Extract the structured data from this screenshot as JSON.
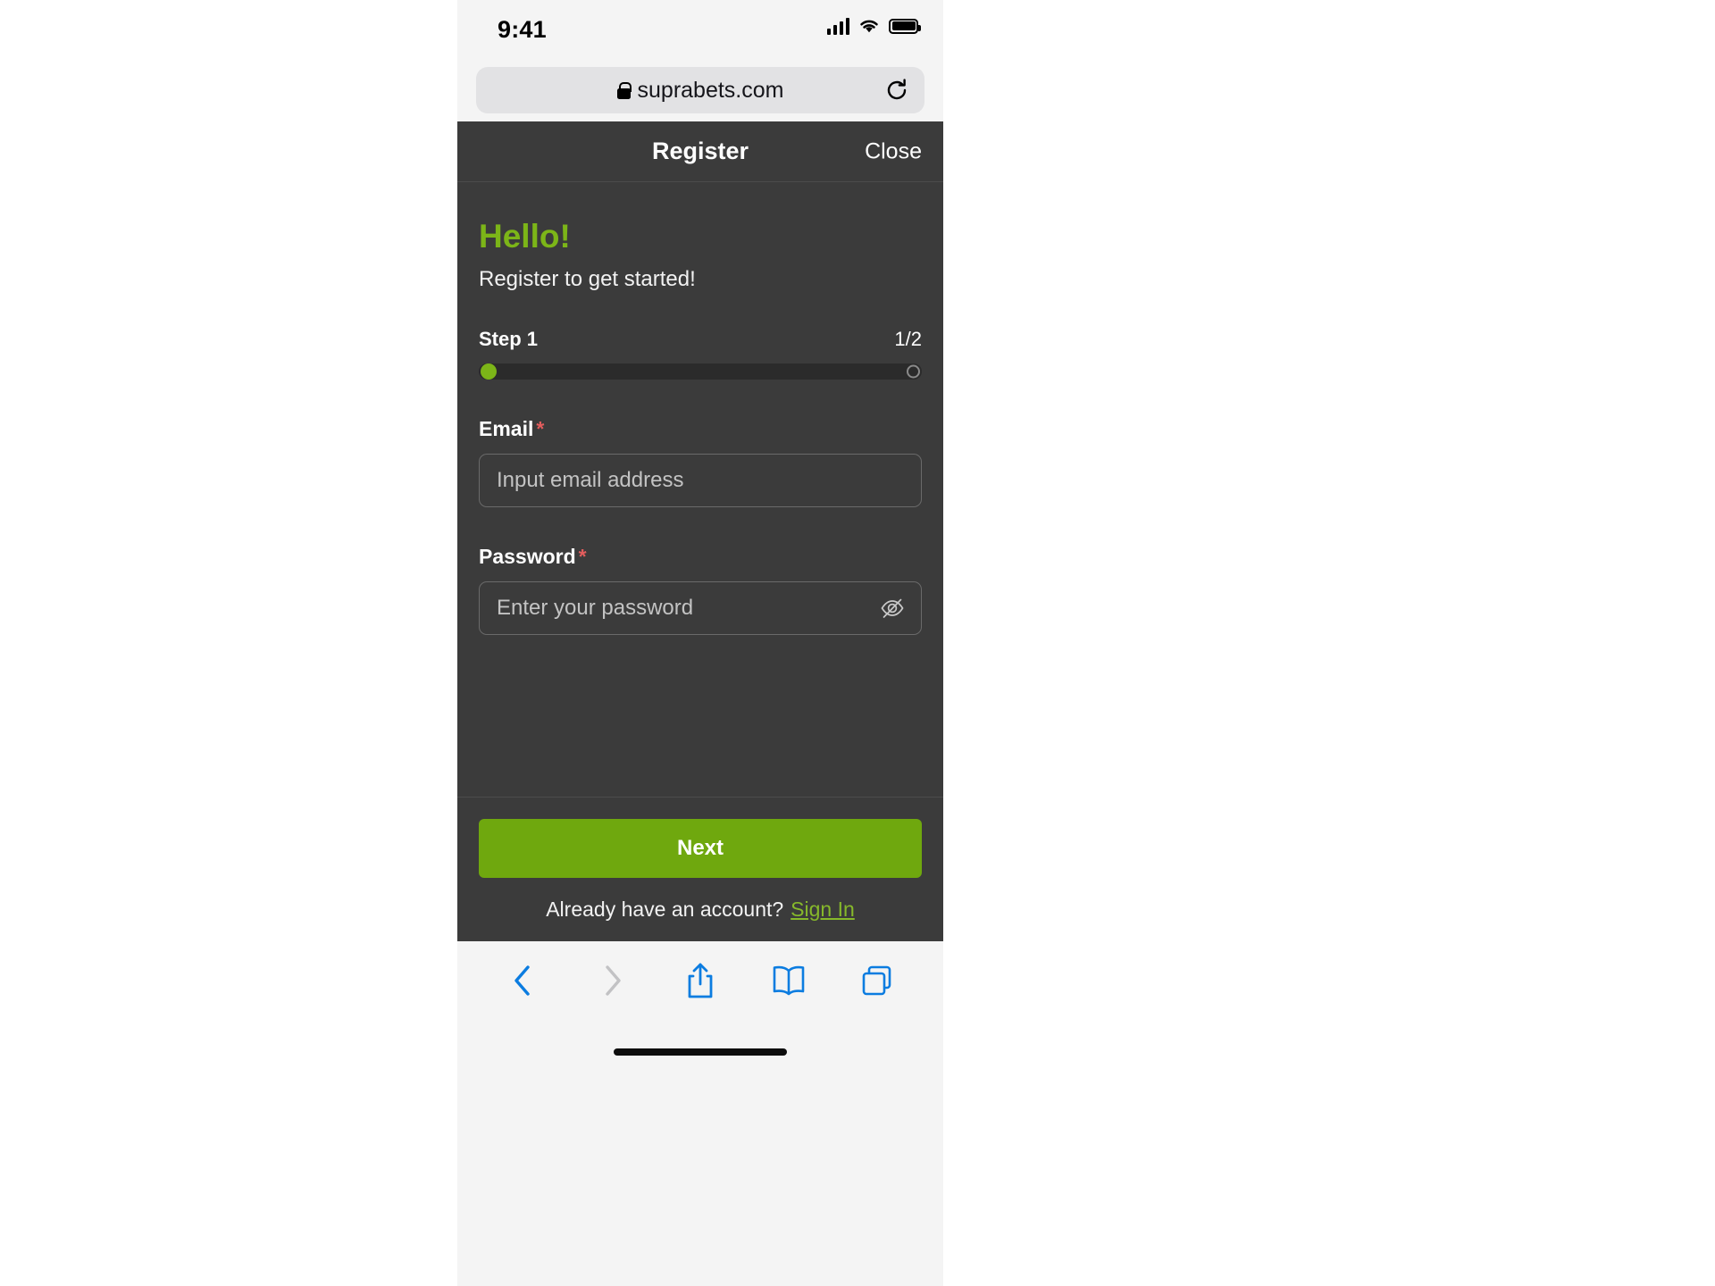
{
  "status_bar": {
    "time": "9:41",
    "cellular_icon": "cellular-signal-icon",
    "wifi_icon": "wifi-icon",
    "battery_icon": "battery-icon"
  },
  "browser": {
    "url": "suprabets.com",
    "lock_icon": "lock-icon",
    "reload_icon": "reload-icon"
  },
  "modal": {
    "title": "Register",
    "close_label": "Close",
    "heading": "Hello!",
    "subtitle": "Register to get started!",
    "step": {
      "label": "Step 1",
      "counter": "1/2",
      "current": 1,
      "total": 2
    },
    "fields": [
      {
        "label": "Email",
        "required_marker": "*",
        "value": "",
        "placeholder": "Input email address"
      },
      {
        "label": "Password",
        "required_marker": "*",
        "value": "",
        "placeholder": "Enter your password",
        "toggle_icon": "eye-off-icon"
      }
    ],
    "primary_button": "Next",
    "footer_text": "Already have an account?",
    "footer_link": "Sign In"
  },
  "toolbar": {
    "back_icon": "chevron-left-icon",
    "forward_icon": "chevron-right-icon",
    "share_icon": "share-icon",
    "bookmarks_icon": "book-icon",
    "tabs_icon": "tabs-icon"
  },
  "colors": {
    "accent_green": "#7cb518",
    "button_green": "#6fa80e",
    "link_green": "#86b82b",
    "required_red": "#e35d5d",
    "modal_bg": "#3b3b3b",
    "toolbar_blue": "#0b7ce0"
  }
}
